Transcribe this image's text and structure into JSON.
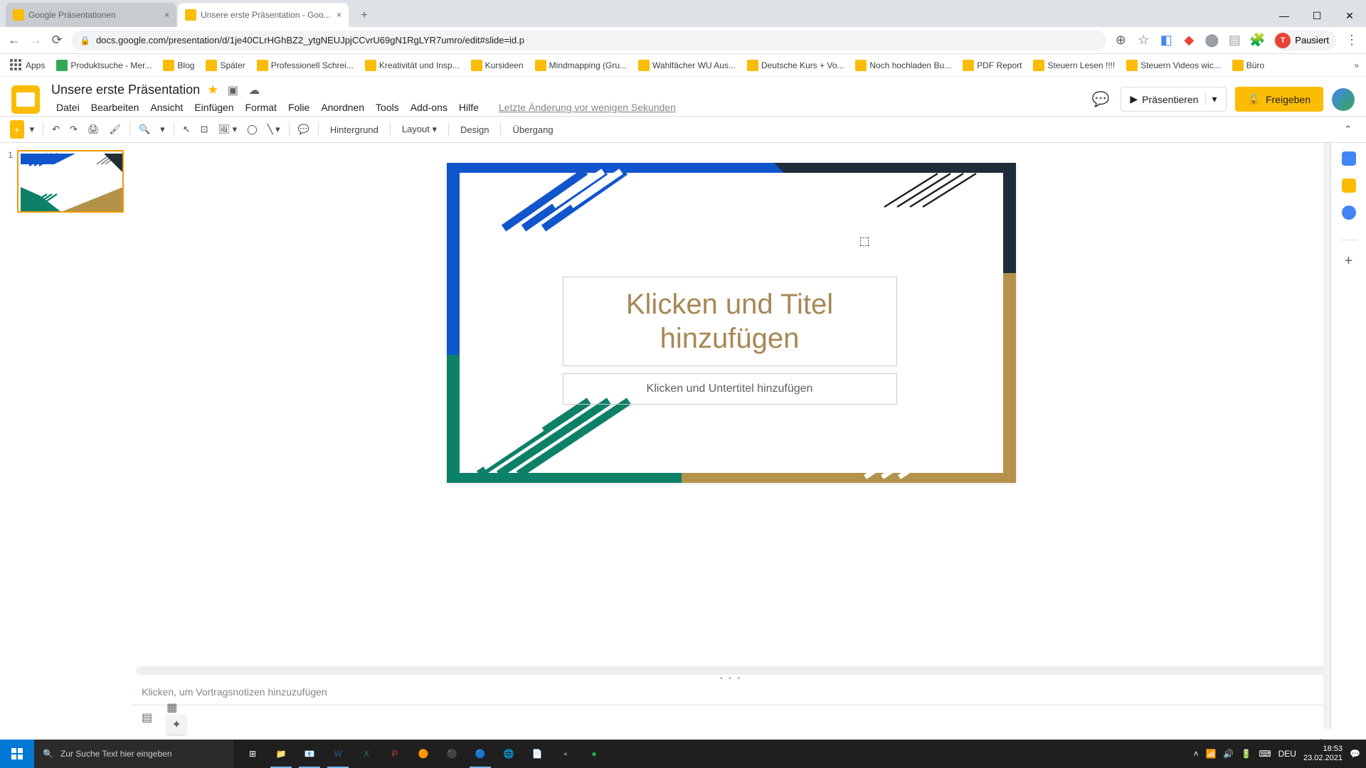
{
  "browser": {
    "tabs": [
      {
        "title": "Google Präsentationen"
      },
      {
        "title": "Unsere erste Präsentation - Goo..."
      }
    ],
    "url": "docs.google.com/presentation/d/1je40CLrHGhBZ2_ytgNEUJpjCCvrU69gN1RgLYR7umro/edit#slide=id.p",
    "pausiert": "Pausiert",
    "pausiert_initial": "T"
  },
  "bookmarks": {
    "apps": "Apps",
    "items": [
      "Produktsuche - Mer...",
      "Blog",
      "Später",
      "Professionell Schrei...",
      "Kreativität und Insp...",
      "Kursideen",
      "Mindmapping (Gru...",
      "Wahlfächer WU Aus...",
      "Deutsche Kurs + Vo...",
      "Noch hochladen Bu...",
      "PDF Report",
      "Steuern Lesen !!!!",
      "Steuern Videos wic...",
      "Büro"
    ]
  },
  "doc": {
    "title": "Unsere erste Präsentation",
    "menus": [
      "Datei",
      "Bearbeiten",
      "Ansicht",
      "Einfügen",
      "Format",
      "Folie",
      "Anordnen",
      "Tools",
      "Add-ons",
      "Hilfe"
    ],
    "last_edit": "Letzte Änderung vor wenigen Sekunden",
    "present": "Präsentieren",
    "share": "Freigeben"
  },
  "toolbar": {
    "background": "Hintergrund",
    "layout": "Layout",
    "design": "Design",
    "transition": "Übergang"
  },
  "slide": {
    "num": "1",
    "title_placeholder": "Klicken und Titel hinzufügen",
    "subtitle_placeholder": "Klicken und Untertitel hinzufügen"
  },
  "notes_placeholder": "Klicken, um Vortragsnotizen hinzuzufügen",
  "taskbar": {
    "search_placeholder": "Zur Suche Text hier eingeben",
    "lang": "DEU",
    "time": "18:53",
    "date": "23.02.2021"
  },
  "colors": {
    "blue": "#1155cc",
    "darknavy": "#1d2d3a",
    "green": "#0d8168",
    "gold": "#b4924a",
    "tan": "#a78855"
  }
}
